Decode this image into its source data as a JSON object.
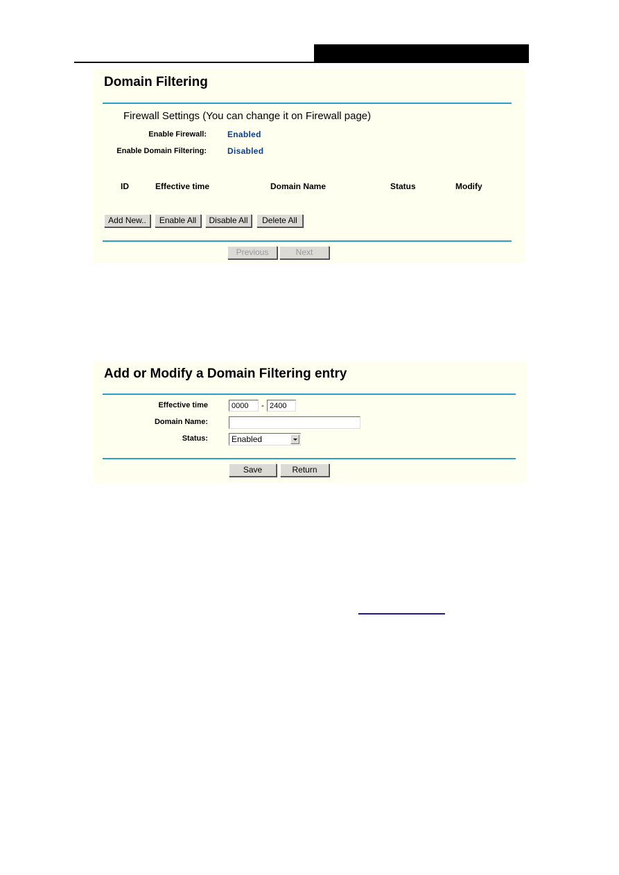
{
  "panel1": {
    "title": "Domain Filtering",
    "firewall_heading": "Firewall Settings (You can change it on Firewall page)",
    "settings": [
      {
        "label": "Enable Firewall:",
        "value": "Enabled"
      },
      {
        "label": "Enable Domain Filtering:",
        "value": "Disabled"
      }
    ],
    "columns": [
      "ID",
      "Effective time",
      "Domain Name",
      "Status",
      "Modify"
    ],
    "rows": [],
    "buttons": {
      "add_new": "Add New..",
      "enable_all": "Enable All",
      "disable_all": "Disable All",
      "delete_all": "Delete All"
    },
    "pagination": {
      "previous": "Previous",
      "next": "Next"
    }
  },
  "panel2": {
    "title": "Add or Modify a Domain Filtering entry",
    "fields": {
      "effective_time": {
        "label": "Effective time",
        "start": "0000",
        "separator": "-",
        "end": "2400"
      },
      "domain_name": {
        "label": "Domain Name:",
        "value": ""
      },
      "status": {
        "label": "Status:",
        "selected": "Enabled"
      }
    },
    "buttons": {
      "save": "Save",
      "return": "Return"
    }
  },
  "colors": {
    "panel_bg": "#fffff0",
    "rule": "#2a9fc9",
    "value_text": "#0b3d91",
    "button_bg": "#dcdad4"
  }
}
